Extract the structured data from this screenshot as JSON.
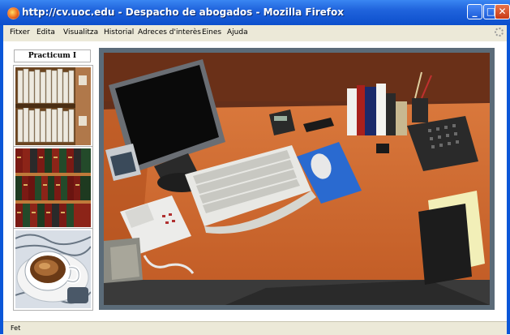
{
  "window": {
    "title": "http://cv.uoc.edu - Despacho de abogados - Mozilla Firefox",
    "buttons": {
      "minimize": "_",
      "maximize": "□",
      "close": "✕"
    }
  },
  "menu": {
    "items": [
      "Fitxer",
      "Edita",
      "Visualitza",
      "Historial",
      "Adreces d'interès",
      "Eines",
      "Ajuda"
    ]
  },
  "sidebar": {
    "title": "Practicum I",
    "thumbnails": [
      {
        "subject": "archive-folders"
      },
      {
        "subject": "law-books"
      },
      {
        "subject": "coffee-cup"
      }
    ]
  },
  "main": {
    "photo_subject": "office-desk"
  },
  "status": {
    "text": "Fet"
  },
  "colors": {
    "titlebar": "#1f63dc",
    "frame_border": "#5b6b78",
    "menubar_bg": "#ece9d8"
  }
}
